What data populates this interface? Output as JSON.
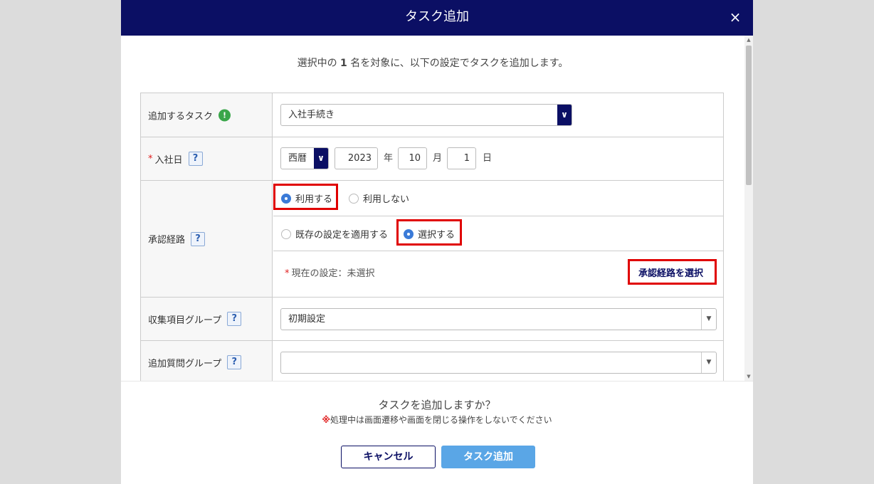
{
  "modal": {
    "title": "タスク追加",
    "close_icon": "×"
  },
  "intro": {
    "prefix": "選択中の ",
    "count": "1",
    "suffix": " 名を対象に、以下の設定でタスクを追加します。"
  },
  "form": {
    "task": {
      "label": "追加するタスク",
      "info_icon": "!",
      "value": "入社手続き"
    },
    "join_date": {
      "required_mark": "*",
      "label": "入社日",
      "help": "?",
      "era": "西暦",
      "year": "2023",
      "year_unit": "年",
      "month": "10",
      "month_unit": "月",
      "day": "1",
      "day_unit": "日"
    },
    "approval": {
      "label": "承認経路",
      "help": "?",
      "use_label": "利用する",
      "not_use_label": "利用しない",
      "existing_label": "既存の設定を適用する",
      "select_label": "選択する",
      "required_mark": "*",
      "current_setting": "現在の設定：未選択",
      "select_button": "承認経路を選択",
      "use_selected": true,
      "select_selected": true
    },
    "collection_group": {
      "label": "収集項目グループ",
      "help": "?",
      "value": "初期設定"
    },
    "question_group": {
      "label": "追加質問グループ",
      "help": "?",
      "value": ""
    }
  },
  "footer": {
    "confirm": "タスクを追加しますか？",
    "warning_mark": "※",
    "warning": "処理中は画面遷移や画面を閉じる操作をしないでください",
    "cancel_label": "キャンセル",
    "add_label": "タスク追加"
  },
  "colors": {
    "header": "#0b0f64",
    "primary_button": "#5aa6e6",
    "highlight": "#e00000"
  }
}
